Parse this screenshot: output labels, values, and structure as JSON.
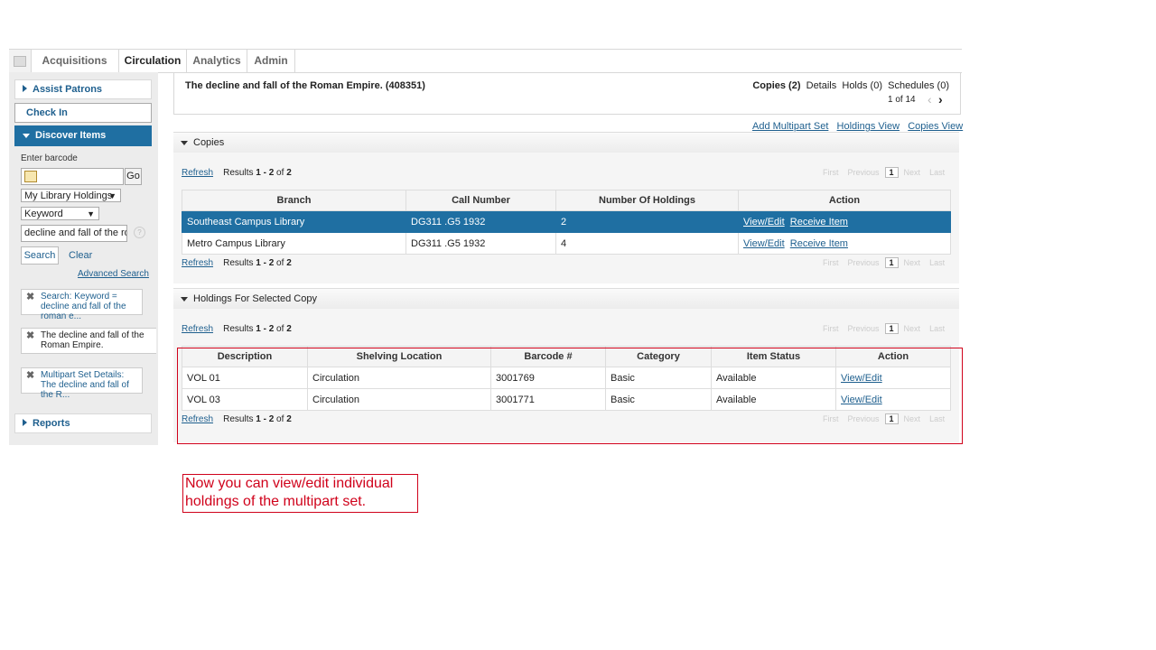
{
  "tabs": [
    "Acquisitions",
    "Circulation",
    "Analytics",
    "Admin"
  ],
  "sidebar": {
    "assist_patrons": "Assist Patrons",
    "check_in": "Check In",
    "discover_items": "Discover Items",
    "barcode_label": "Enter barcode",
    "go": "Go",
    "scope": "My Library Holdings",
    "search_type": "Keyword",
    "search_value": "decline and fall of the ron",
    "search_btn": "Search",
    "clear": "Clear",
    "advanced": "Advanced Search",
    "help": "?",
    "filters": [
      "Search: Keyword = decline and fall of the roman e...",
      "The decline and fall of the Roman Empire.",
      "Multipart Set Details: The decline and fall of the R..."
    ],
    "reports": "Reports"
  },
  "header": {
    "title": "The decline and fall of the Roman Empire. (408351)",
    "copies": "Copies (2)",
    "details": "Details",
    "holds": "Holds (0)",
    "schedules": "Schedules (0)",
    "paging": "1 of 14"
  },
  "view_links": [
    "Add Multipart Set",
    "Holdings View",
    "Copies View"
  ],
  "pager": {
    "first": "First",
    "previous": "Previous",
    "page": "1",
    "next": "Next",
    "last": "Last"
  },
  "refresh": "Refresh",
  "results_prefix": "Results ",
  "results_range": "1 - 2",
  "results_of": " of ",
  "results_total": "2",
  "copies_section": {
    "title": "Copies",
    "headers": [
      "Branch",
      "Call Number",
      "Number Of Holdings",
      "Action"
    ],
    "rows": [
      {
        "branch": "Southeast Campus Library",
        "call": "DG311 .G5 1932",
        "count": "2",
        "a1": "View/Edit",
        "a2": "Receive Item"
      },
      {
        "branch": "Metro Campus Library",
        "call": "DG311 .G5 1932",
        "count": "4",
        "a1": "View/Edit",
        "a2": "Receive Item"
      }
    ]
  },
  "holdings_section": {
    "title": "Holdings For Selected Copy",
    "headers": [
      "Description",
      "Shelving Location",
      "Barcode #",
      "Category",
      "Item Status",
      "Action"
    ],
    "rows": [
      {
        "desc": "VOL 01",
        "loc": "Circulation",
        "barcode": "3001769",
        "cat": "Basic",
        "status": "Available",
        "action": "View/Edit"
      },
      {
        "desc": "VOL 03",
        "loc": "Circulation",
        "barcode": "3001771",
        "cat": "Basic",
        "status": "Available",
        "action": "View/Edit"
      }
    ]
  },
  "annotation": "Now you can view/edit individual holdings of the multipart set.",
  "colors": {
    "accent": "#1e5f8e",
    "selected_row": "#1f6fa2",
    "annotation": "#d0021b"
  }
}
